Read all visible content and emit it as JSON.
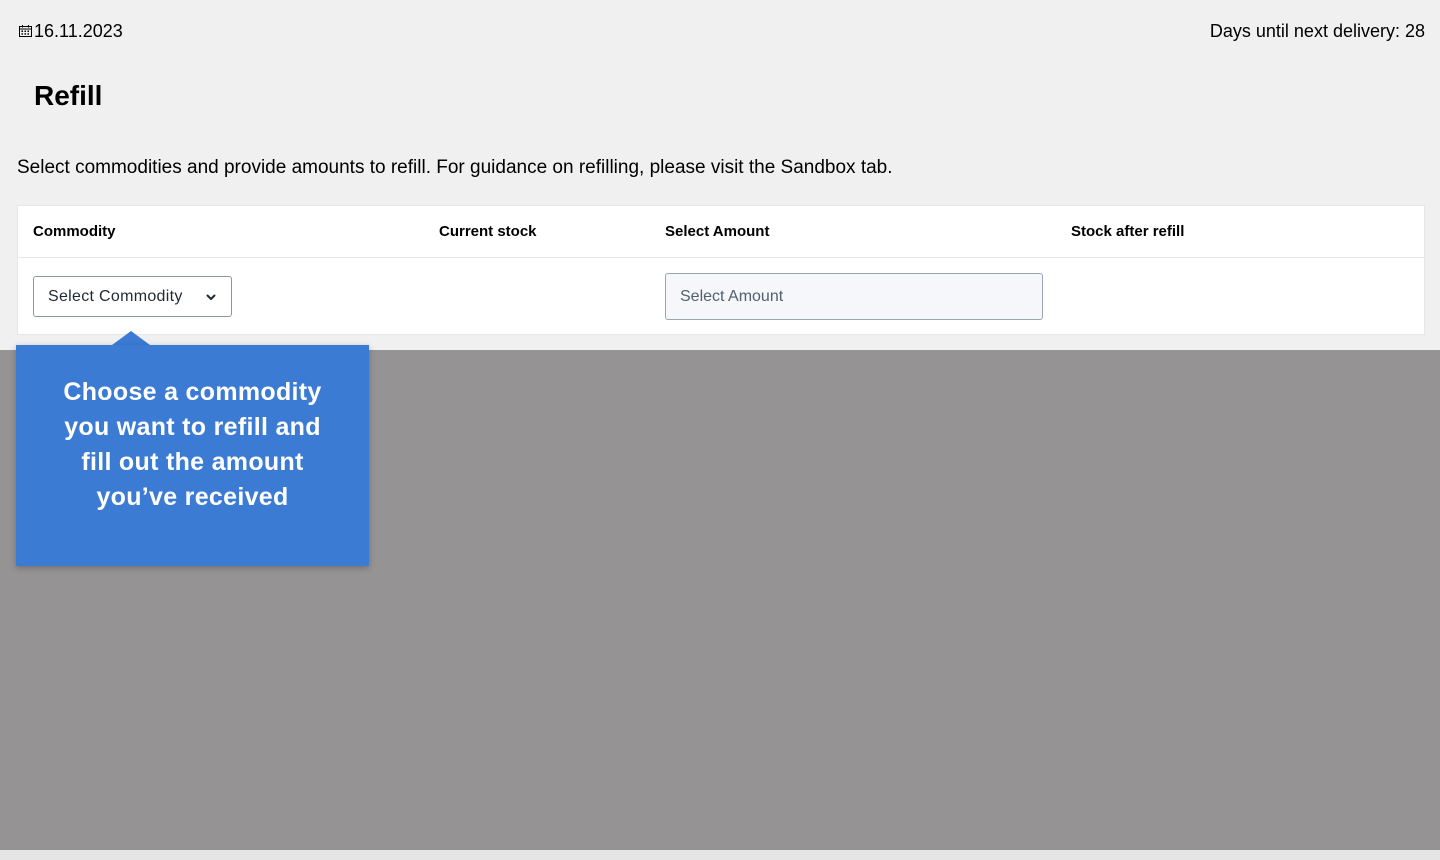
{
  "header": {
    "date": "16.11.2023",
    "delivery_text": "Days until next delivery: 28"
  },
  "page": {
    "title": "Refill",
    "intro": "Select commodities and provide amounts to refill. For guidance on refilling, please visit the Sandbox tab."
  },
  "table": {
    "columns": [
      "Commodity",
      "Current stock",
      "Select Amount",
      "Stock after refill"
    ],
    "row": {
      "commodity_select": "Select Commodity",
      "amount_placeholder": "Select Amount"
    }
  },
  "tooltip": {
    "text": "Choose a commodity you want to refill and fill out the amount you’ve received"
  },
  "icons": {
    "date": "calendar-icon",
    "select": "chevron-down-icon"
  },
  "colors": {
    "tooltip_bg": "#3b7bd4",
    "overlay": "#959394"
  }
}
